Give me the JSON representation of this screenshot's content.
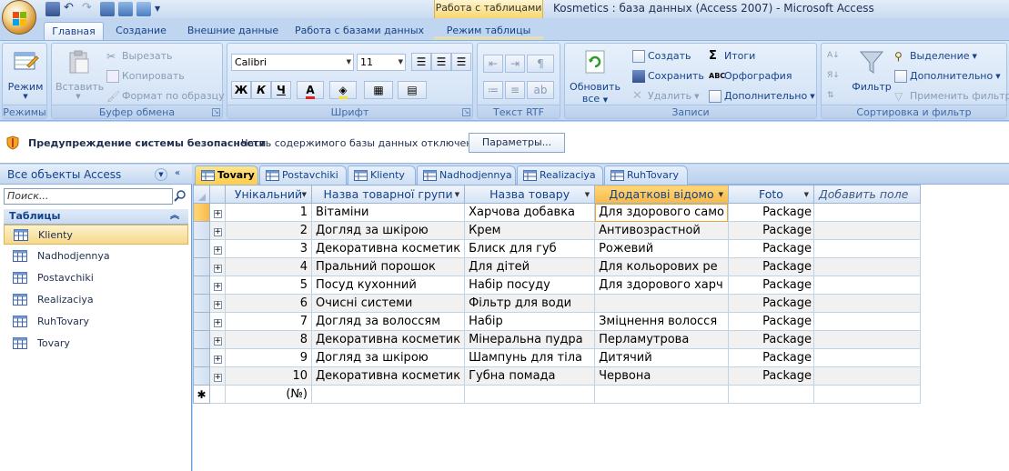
{
  "window": {
    "app_title": "Kosmetics : база данных (Access 2007) - Microsoft Access",
    "context_tab_title": "Работа с таблицами"
  },
  "ribbon_tabs": [
    {
      "label": "Главная",
      "active": true
    },
    {
      "label": "Создание",
      "active": false
    },
    {
      "label": "Внешние данные",
      "active": false
    },
    {
      "label": "Работа с базами данных",
      "active": false
    },
    {
      "label": "Режим таблицы",
      "active": false
    }
  ],
  "ribbon": {
    "views": {
      "caption": "Режимы",
      "view_label": "Режим"
    },
    "clipboard": {
      "caption": "Буфер обмена",
      "paste_label": "Вставить",
      "cut_label": "Вырезать",
      "copy_label": "Копировать",
      "format_painter_label": "Формат по образцу"
    },
    "font": {
      "caption": "Шрифт",
      "font_name": "Calibri",
      "font_size": "11",
      "bold": "Ж",
      "italic": "К",
      "underline": "Ч"
    },
    "rtf": {
      "caption": "Текст RTF"
    },
    "records": {
      "caption": "Записи",
      "refresh_label": "Обновить",
      "refresh_sub": "все",
      "new_label": "Создать",
      "save_label": "Сохранить",
      "delete_label": "Удалить",
      "totals_label": "Итоги",
      "spelling_label": "Орфография",
      "more_label": "Дополнительно"
    },
    "sortfilter": {
      "caption": "Сортировка и фильтр",
      "filter_label": "Фильтр",
      "selection_label": "Выделение",
      "advanced_label": "Дополнительно",
      "toggle_filter_label": "Применить фильтр"
    }
  },
  "security": {
    "title": "Предупреждение системы безопасности",
    "message": "Часть содержимого базы данных отключено",
    "button_label": "Параметры..."
  },
  "nav": {
    "title": "Все объекты Access",
    "search_placeholder": "Поиск...",
    "section_label": "Таблицы",
    "items": [
      {
        "label": "Klienty",
        "selected": true
      },
      {
        "label": "Nadhodjennya",
        "selected": false
      },
      {
        "label": "Postavchiki",
        "selected": false
      },
      {
        "label": "Realizaciya",
        "selected": false
      },
      {
        "label": "RuhTovary",
        "selected": false
      },
      {
        "label": "Tovary",
        "selected": false
      }
    ]
  },
  "doc_tabs": [
    {
      "label": "Tovary",
      "active": true
    },
    {
      "label": "Postavchiki",
      "active": false
    },
    {
      "label": "Klienty",
      "active": false
    },
    {
      "label": "Nadhodjennya",
      "active": false
    },
    {
      "label": "Realizaciya",
      "active": false
    },
    {
      "label": "RuhTovary",
      "active": false
    }
  ],
  "grid": {
    "columns": [
      "Унікальний",
      "Назва товарної групи",
      "Назва товару",
      "Додаткові відомо",
      "Foto",
      "Добавить поле"
    ],
    "rows": [
      {
        "id": "1",
        "group": "Вітаміни",
        "name": "Харчова добавка",
        "info": "Для здорового само",
        "foto": "Package"
      },
      {
        "id": "2",
        "group": "Догляд за шкірою",
        "name": "Крем",
        "info": "Антивозрастной",
        "foto": "Package"
      },
      {
        "id": "3",
        "group": "Декоративна косметик",
        "name": "Блиск для губ",
        "info": "Рожевий",
        "foto": "Package"
      },
      {
        "id": "4",
        "group": "Пральний порошок",
        "name": "Для дітей",
        "info": "Для кольорових ре",
        "foto": "Package"
      },
      {
        "id": "5",
        "group": "Посуд кухонний",
        "name": "Набір посуду",
        "info": "Для здорового харч",
        "foto": "Package"
      },
      {
        "id": "6",
        "group": "Очисні системи",
        "name": "Фільтр для води",
        "info": "",
        "foto": "Package"
      },
      {
        "id": "7",
        "group": "Догляд за волоссям",
        "name": "Набір",
        "info": "Зміцнення волосся",
        "foto": "Package"
      },
      {
        "id": "8",
        "group": "Декоративна косметик",
        "name": "Мінеральна пудра",
        "info": "Перламутрова",
        "foto": "Package"
      },
      {
        "id": "9",
        "group": "Догляд за шкірою",
        "name": "Шампунь для тіла",
        "info": "Дитячий",
        "foto": "Package"
      },
      {
        "id": "10",
        "group": "Декоративна косметик",
        "name": "Губна помада",
        "info": "Червона",
        "foto": "Package"
      }
    ],
    "new_row_id": "(№)",
    "new_row_marker": "✱"
  }
}
